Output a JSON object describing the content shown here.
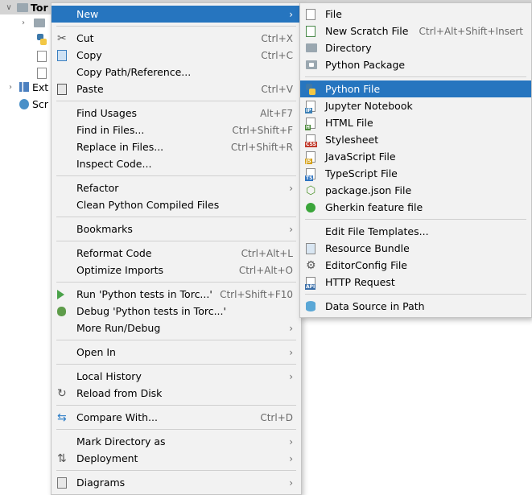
{
  "tree": {
    "root_label": "Tor",
    "ext_label": "Ext",
    "scr_label": "Scr"
  },
  "main_menu": [
    {
      "label": "New",
      "shortcut": "",
      "submenu": true,
      "icon": "",
      "selected": true
    },
    {
      "sep": true
    },
    {
      "label": "Cut",
      "shortcut": "Ctrl+X",
      "icon": "scissors-icon"
    },
    {
      "label": "Copy",
      "shortcut": "Ctrl+C",
      "icon": "copy-icon"
    },
    {
      "label": "Copy Path/Reference...",
      "shortcut": "",
      "icon": ""
    },
    {
      "label": "Paste",
      "shortcut": "Ctrl+V",
      "icon": "paste-icon"
    },
    {
      "sep": true
    },
    {
      "label": "Find Usages",
      "shortcut": "Alt+F7",
      "icon": ""
    },
    {
      "label": "Find in Files...",
      "shortcut": "Ctrl+Shift+F",
      "icon": ""
    },
    {
      "label": "Replace in Files...",
      "shortcut": "Ctrl+Shift+R",
      "icon": ""
    },
    {
      "label": "Inspect Code...",
      "shortcut": "",
      "icon": ""
    },
    {
      "sep": true
    },
    {
      "label": "Refactor",
      "shortcut": "",
      "submenu": true,
      "icon": ""
    },
    {
      "label": "Clean Python Compiled Files",
      "shortcut": "",
      "icon": ""
    },
    {
      "sep": true
    },
    {
      "label": "Bookmarks",
      "shortcut": "",
      "submenu": true,
      "icon": ""
    },
    {
      "sep": true
    },
    {
      "label": "Reformat Code",
      "shortcut": "Ctrl+Alt+L",
      "icon": ""
    },
    {
      "label": "Optimize Imports",
      "shortcut": "Ctrl+Alt+O",
      "icon": ""
    },
    {
      "sep": true
    },
    {
      "label": "Run 'Python tests in Torc...'",
      "shortcut": "Ctrl+Shift+F10",
      "icon": "run-icon"
    },
    {
      "label": "Debug 'Python tests in Torc...'",
      "shortcut": "",
      "icon": "debug-icon"
    },
    {
      "label": "More Run/Debug",
      "shortcut": "",
      "submenu": true,
      "icon": ""
    },
    {
      "sep": true
    },
    {
      "label": "Open In",
      "shortcut": "",
      "submenu": true,
      "icon": ""
    },
    {
      "sep": true
    },
    {
      "label": "Local History",
      "shortcut": "",
      "submenu": true,
      "icon": ""
    },
    {
      "label": "Reload from Disk",
      "shortcut": "",
      "icon": "reload-icon"
    },
    {
      "sep": true
    },
    {
      "label": "Compare With...",
      "shortcut": "Ctrl+D",
      "icon": "compare-icon"
    },
    {
      "sep": true
    },
    {
      "label": "Mark Directory as",
      "shortcut": "",
      "submenu": true,
      "icon": ""
    },
    {
      "label": "Deployment",
      "shortcut": "",
      "submenu": true,
      "icon": "deployment-icon"
    },
    {
      "sep": true
    },
    {
      "label": "Diagrams",
      "shortcut": "",
      "submenu": true,
      "icon": "diagrams-icon"
    }
  ],
  "sub_menu": [
    {
      "label": "File",
      "shortcut": "",
      "icon": "file-icon"
    },
    {
      "label": "New Scratch File",
      "shortcut": "Ctrl+Alt+Shift+Insert",
      "icon": "scratch-file-icon"
    },
    {
      "label": "Directory",
      "shortcut": "",
      "icon": "folder-icon"
    },
    {
      "label": "Python Package",
      "shortcut": "",
      "icon": "python-package-icon"
    },
    {
      "sep": true
    },
    {
      "label": "Python File",
      "shortcut": "",
      "icon": "python-file-icon",
      "selected": true
    },
    {
      "label": "Jupyter Notebook",
      "shortcut": "",
      "icon": "jupyter-icon"
    },
    {
      "label": "HTML File",
      "shortcut": "",
      "icon": "html-file-icon"
    },
    {
      "label": "Stylesheet",
      "shortcut": "",
      "icon": "css-file-icon"
    },
    {
      "label": "JavaScript File",
      "shortcut": "",
      "icon": "js-file-icon"
    },
    {
      "label": "TypeScript File",
      "shortcut": "",
      "icon": "ts-file-icon"
    },
    {
      "label": "package.json File",
      "shortcut": "",
      "icon": "nodejs-icon"
    },
    {
      "label": "Gherkin feature file",
      "shortcut": "",
      "icon": "gherkin-icon"
    },
    {
      "sep": true
    },
    {
      "label": "Edit File Templates...",
      "shortcut": "",
      "icon": ""
    },
    {
      "label": "Resource Bundle",
      "shortcut": "",
      "icon": "resource-bundle-icon"
    },
    {
      "label": "EditorConfig File",
      "shortcut": "",
      "icon": "editorconfig-icon"
    },
    {
      "label": "HTTP Request",
      "shortcut": "",
      "icon": "http-request-icon"
    },
    {
      "sep": true
    },
    {
      "label": "Data Source in Path",
      "shortcut": "",
      "icon": "database-icon"
    }
  ],
  "colors": {
    "selection": "#2675bf",
    "menu_bg": "#f2f2f2"
  }
}
